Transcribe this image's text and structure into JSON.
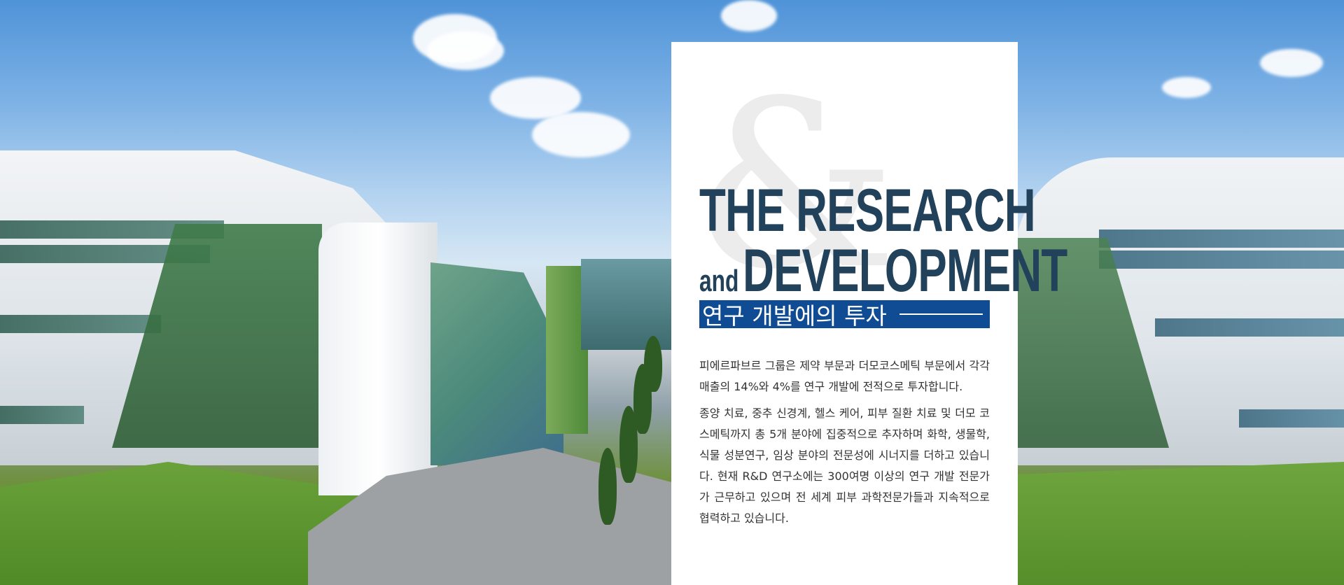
{
  "hero": {
    "image_alt": "Research center buildings"
  },
  "card": {
    "ampersand": "&",
    "title_line1": "THE RESEARCH",
    "title_and": "and",
    "title_line2": "DEVELOPMENT",
    "subtitle": "연구 개발에의 투자",
    "paragraph1": "피에르파브르 그룹은 제약 부문과 더모코스메틱 부문에서 각각 매출의 14%와 4%를 연구 개발에 전적으로 투자합니다.",
    "paragraph2": "종양 치료, 중추 신경계, 헬스 케어, 피부 질환 치료 및 더모 코스메틱까지 총 5개 분야에 집중적으로 추자하며 화학, 생물학, 식물 성분연구, 임상 분야의 전문성에 시너지를 더하고 있습니다. 현재 R&D 연구소에는 300여명 이상의 연구 개발 전문가가 근무하고 있으며 전 세계 피부 과학전문가들과 지속적으로 협력하고 있습니다."
  },
  "colors": {
    "title": "#21425a",
    "subtitle_bg": "#0f4c94",
    "body_text": "#333333"
  }
}
